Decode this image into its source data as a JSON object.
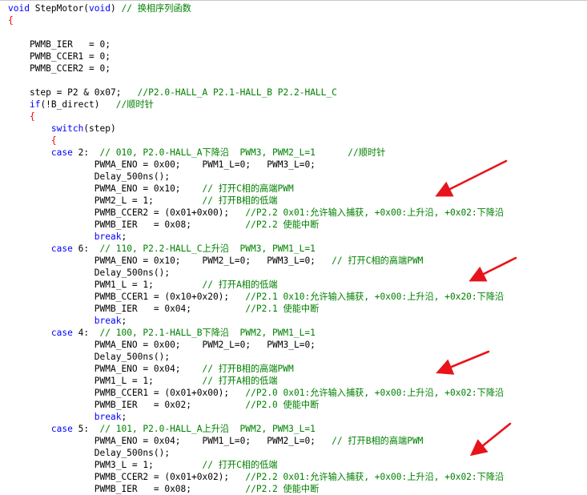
{
  "colors": {
    "keyword": "#0000ff",
    "comment": "#008000",
    "brace": "#ff0000",
    "text": "#000000",
    "arrow": "#e8141b",
    "background": "#ffffff"
  },
  "lines": [
    [
      {
        "t": "void",
        "c": "kw"
      },
      {
        "t": " StepMotor("
      },
      {
        "t": "void",
        "c": "kw"
      },
      {
        "t": ") "
      },
      {
        "t": "// 换相序列函数",
        "c": "cm"
      }
    ],
    [
      {
        "t": "{",
        "c": "br"
      }
    ],
    [],
    [
      {
        "t": "    PWMB_IER   = 0;"
      }
    ],
    [
      {
        "t": "    PWMB_CCER1 = 0;"
      }
    ],
    [
      {
        "t": "    PWMB_CCER2 = 0;"
      }
    ],
    [],
    [
      {
        "t": "    step = P2 & 0x07;   "
      },
      {
        "t": "//P2.0-HALL_A P2.1-HALL_B P2.2-HALL_C",
        "c": "cm"
      }
    ],
    [
      {
        "t": "    "
      },
      {
        "t": "if",
        "c": "kw"
      },
      {
        "t": "(!B_direct)   "
      },
      {
        "t": "//顺时针",
        "c": "cm"
      }
    ],
    [
      {
        "t": "    "
      },
      {
        "t": "{",
        "c": "br"
      }
    ],
    [
      {
        "t": "        "
      },
      {
        "t": "switch",
        "c": "kw"
      },
      {
        "t": "(step)"
      }
    ],
    [
      {
        "t": "        "
      },
      {
        "t": "{",
        "c": "br"
      }
    ],
    [
      {
        "t": "        "
      },
      {
        "t": "case",
        "c": "kw"
      },
      {
        "t": " 2:  "
      },
      {
        "t": "// 010, P2.0-HALL_A下降沿  PWM3, PWM2_L=1      //顺时针",
        "c": "cm"
      }
    ],
    [
      {
        "t": "                PWMA_ENO = 0x00;    PWM1_L=0;   PWM3_L=0;"
      }
    ],
    [
      {
        "t": "                Delay_500ns();"
      }
    ],
    [
      {
        "t": "                PWMA_ENO = 0x10;    "
      },
      {
        "t": "// 打开C相的高端PWM",
        "c": "cm"
      }
    ],
    [
      {
        "t": "                PWM2_L = 1;         "
      },
      {
        "t": "// 打开B相的低端",
        "c": "cm"
      }
    ],
    [
      {
        "t": "                PWMB_CCER2 = (0x01+0x00);   "
      },
      {
        "t": "//P2.2 0x01:允许输入捕获, +0x00:上升沿, +0x02:下降沿",
        "c": "cm"
      }
    ],
    [
      {
        "t": "                PWMB_IER   = 0x08;          "
      },
      {
        "t": "//P2.2 使能中断",
        "c": "cm"
      }
    ],
    [
      {
        "t": "                "
      },
      {
        "t": "break",
        "c": "kw"
      },
      {
        "t": ";"
      }
    ],
    [
      {
        "t": "        "
      },
      {
        "t": "case",
        "c": "kw"
      },
      {
        "t": " 6:  "
      },
      {
        "t": "// 110, P2.2-HALL_C上升沿  PWM3, PWM1_L=1",
        "c": "cm"
      }
    ],
    [
      {
        "t": "                PWMA_ENO = 0x10;    PWM2_L=0;   PWM3_L=0;   "
      },
      {
        "t": "// 打开C相的高端PWM",
        "c": "cm"
      }
    ],
    [
      {
        "t": "                Delay_500ns();"
      }
    ],
    [
      {
        "t": "                PWM1_L = 1;         "
      },
      {
        "t": "// 打开A相的低端",
        "c": "cm"
      }
    ],
    [
      {
        "t": "                PWMB_CCER1 = (0x10+0x20);   "
      },
      {
        "t": "//P2.1 0x10:允许输入捕获, +0x00:上升沿, +0x20:下降沿",
        "c": "cm"
      }
    ],
    [
      {
        "t": "                PWMB_IER   = 0x04;          "
      },
      {
        "t": "//P2.1 使能中断",
        "c": "cm"
      }
    ],
    [
      {
        "t": "                "
      },
      {
        "t": "break",
        "c": "kw"
      },
      {
        "t": ";"
      }
    ],
    [
      {
        "t": "        "
      },
      {
        "t": "case",
        "c": "kw"
      },
      {
        "t": " 4:  "
      },
      {
        "t": "// 100, P2.1-HALL_B下降沿  PWM2, PWM1_L=1",
        "c": "cm"
      }
    ],
    [
      {
        "t": "                PWMA_ENO = 0x00;    PWM2_L=0;   PWM3_L=0;"
      }
    ],
    [
      {
        "t": "                Delay_500ns();"
      }
    ],
    [
      {
        "t": "                PWMA_ENO = 0x04;    "
      },
      {
        "t": "// 打开B相的高端PWM",
        "c": "cm"
      }
    ],
    [
      {
        "t": "                PWM1_L = 1;         "
      },
      {
        "t": "// 打开A相的低端",
        "c": "cm"
      }
    ],
    [
      {
        "t": "                PWMB_CCER1 = (0x01+0x00);   "
      },
      {
        "t": "//P2.0 0x01:允许输入捕获, +0x00:上升沿, +0x02:下降沿",
        "c": "cm"
      }
    ],
    [
      {
        "t": "                PWMB_IER   = 0x02;          "
      },
      {
        "t": "//P2.0 使能中断",
        "c": "cm"
      }
    ],
    [
      {
        "t": "                "
      },
      {
        "t": "break",
        "c": "kw"
      },
      {
        "t": ";"
      }
    ],
    [
      {
        "t": "        "
      },
      {
        "t": "case",
        "c": "kw"
      },
      {
        "t": " 5:  "
      },
      {
        "t": "// 101, P2.0-HALL_A上升沿  PWM2, PWM3_L=1",
        "c": "cm"
      }
    ],
    [
      {
        "t": "                PWMA_ENO = 0x04;    PWM1_L=0;   PWM2_L=0;   "
      },
      {
        "t": "// 打开B相的高端PWM",
        "c": "cm"
      }
    ],
    [
      {
        "t": "                Delay_500ns();"
      }
    ],
    [
      {
        "t": "                PWM3_L = 1;         "
      },
      {
        "t": "// 打开C相的低端",
        "c": "cm"
      }
    ],
    [
      {
        "t": "                PWMB_CCER2 = (0x01+0x02);   "
      },
      {
        "t": "//P2.2 0x01:允许输入捕获, +0x00:上升沿, +0x02:下降沿",
        "c": "cm"
      }
    ],
    [
      {
        "t": "                PWMB_IER   = 0x08;          "
      },
      {
        "t": "//P2.2 使能中断",
        "c": "cm"
      }
    ]
  ]
}
